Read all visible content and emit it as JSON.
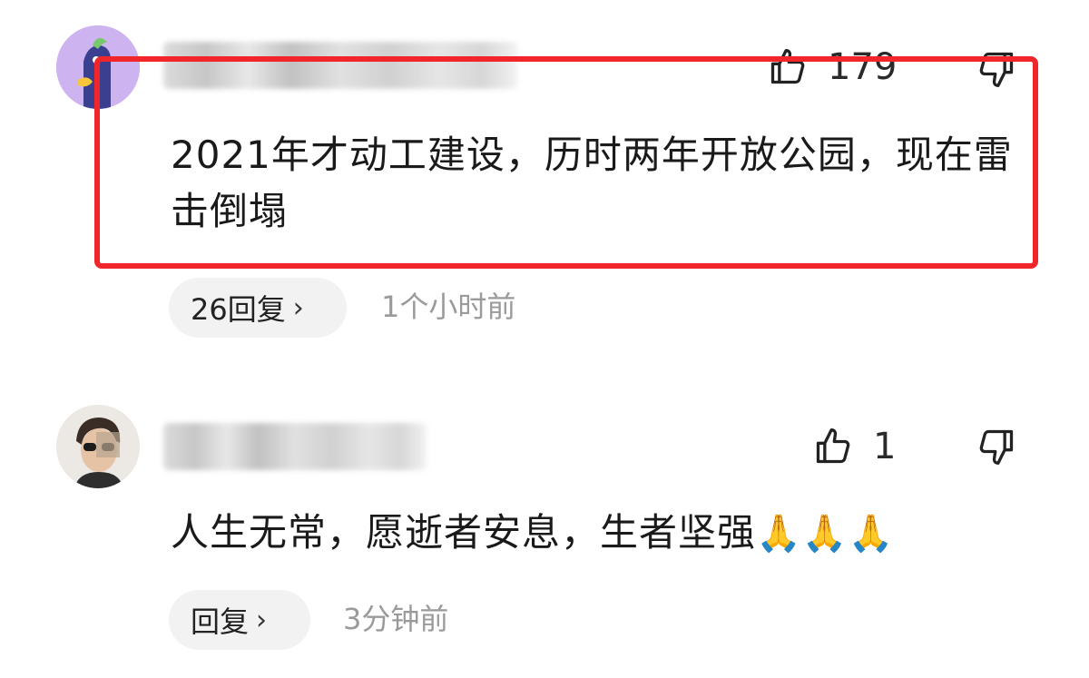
{
  "comments": [
    {
      "likes": "179",
      "text": "2021年才动工建设，历时两年开放公园，现在雷击倒塌",
      "reply_label": "26回复",
      "reply_chevron": "›",
      "time": "1个小时前"
    },
    {
      "likes": "1",
      "text": "人生无常，愿逝者安息，生者坚强",
      "emojis": "🙏🙏🙏",
      "reply_label": "回复",
      "reply_chevron": "›",
      "time": "3分钟前"
    }
  ],
  "colors": {
    "highlight_border": "#f0262b",
    "reply_bg": "#f2f2f2",
    "time_text": "#9a9a9a"
  },
  "icons": [
    "thumbs-up-icon",
    "thumbs-down-icon",
    "chevron-right-icon"
  ]
}
